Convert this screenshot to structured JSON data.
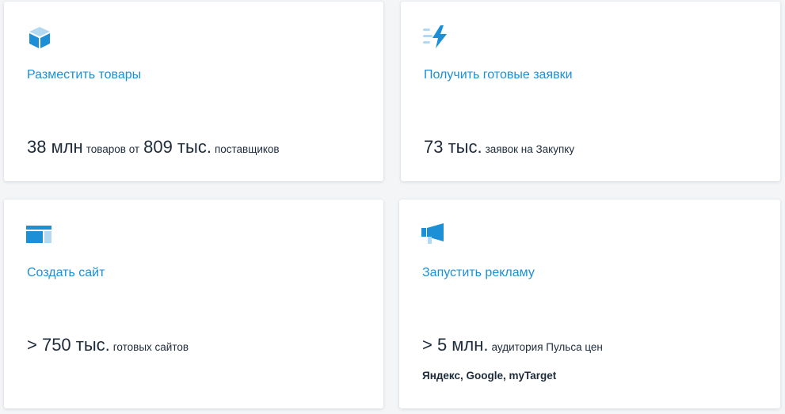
{
  "colors": {
    "accent": "#1c8fd6",
    "accent_light": "#b3d9f2",
    "text": "#1d2b3a"
  },
  "cards": [
    {
      "icon": "cube-icon",
      "link": "Разместить товары",
      "stats": [
        {
          "big": "38 млн",
          "small": "товаров от"
        },
        {
          "big": "809 тыс.",
          "small": "поставщиков"
        }
      ]
    },
    {
      "icon": "lightning-icon",
      "link": "Получить готовые заявки",
      "stats": [
        {
          "big": "73 тыс.",
          "small": "заявок на Закупку"
        }
      ]
    },
    {
      "icon": "website-layout-icon",
      "link": "Создать сайт",
      "stats": [
        {
          "big": "> 750 тыс.",
          "small": "готовых сайтов"
        }
      ]
    },
    {
      "icon": "megaphone-icon",
      "link": "Запустить рекламу",
      "stats": [
        {
          "big": "> 5 млн.",
          "small": "аудитория Пульса цен"
        }
      ],
      "sub": "Яндекс, Google, myTarget"
    }
  ]
}
